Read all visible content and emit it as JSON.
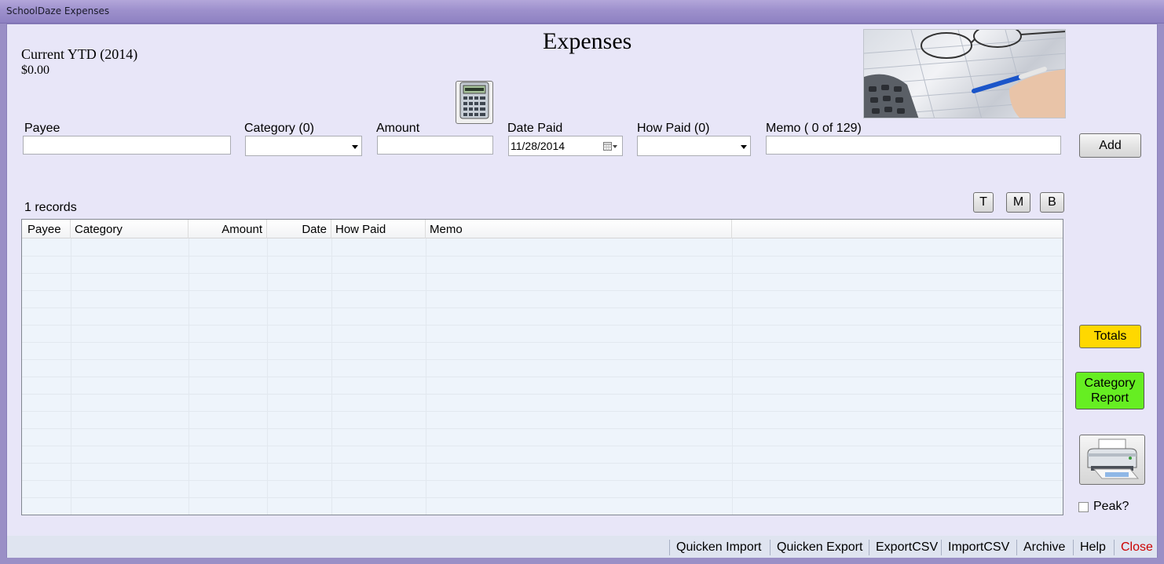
{
  "window": {
    "title": "SchoolDaze Expenses"
  },
  "header": {
    "title": "Expenses",
    "ytd_label": "Current YTD (2014)",
    "ytd_value": "$0.00"
  },
  "form": {
    "payee": {
      "label": "Payee",
      "value": ""
    },
    "category": {
      "label": "Category (0)",
      "value": ""
    },
    "amount": {
      "label": "Amount",
      "value": ""
    },
    "date_paid": {
      "label": "Date Paid",
      "value": "11/28/2014"
    },
    "how_paid": {
      "label": "How Paid (0)",
      "value": ""
    },
    "memo": {
      "label": "Memo ( 0 of 129)",
      "value": ""
    },
    "add_label": "Add"
  },
  "grid": {
    "records_label": "1 records",
    "buttons": {
      "top": "T",
      "middle": "M",
      "bottom": "B"
    },
    "columns": [
      "Payee",
      "Category",
      "Amount",
      "Date",
      "How Paid",
      "Memo"
    ]
  },
  "side": {
    "totals_label": "Totals",
    "category_report_line1": "Category",
    "category_report_line2": "Report",
    "peak_label": "Peak?",
    "colors": {
      "totals": "#ffd800",
      "category_report": "#66ee22"
    }
  },
  "menu": {
    "items": [
      "Quicken Import",
      "Quicken Export",
      "ExportCSV",
      "ImportCSV",
      "Archive",
      "Help",
      "Close"
    ],
    "close_color": "#cc0000"
  },
  "icons": {
    "calculator": "calculator-icon",
    "calendar": "calendar-icon",
    "printer": "printer-icon",
    "photo": "calculator-glasses-photo"
  }
}
